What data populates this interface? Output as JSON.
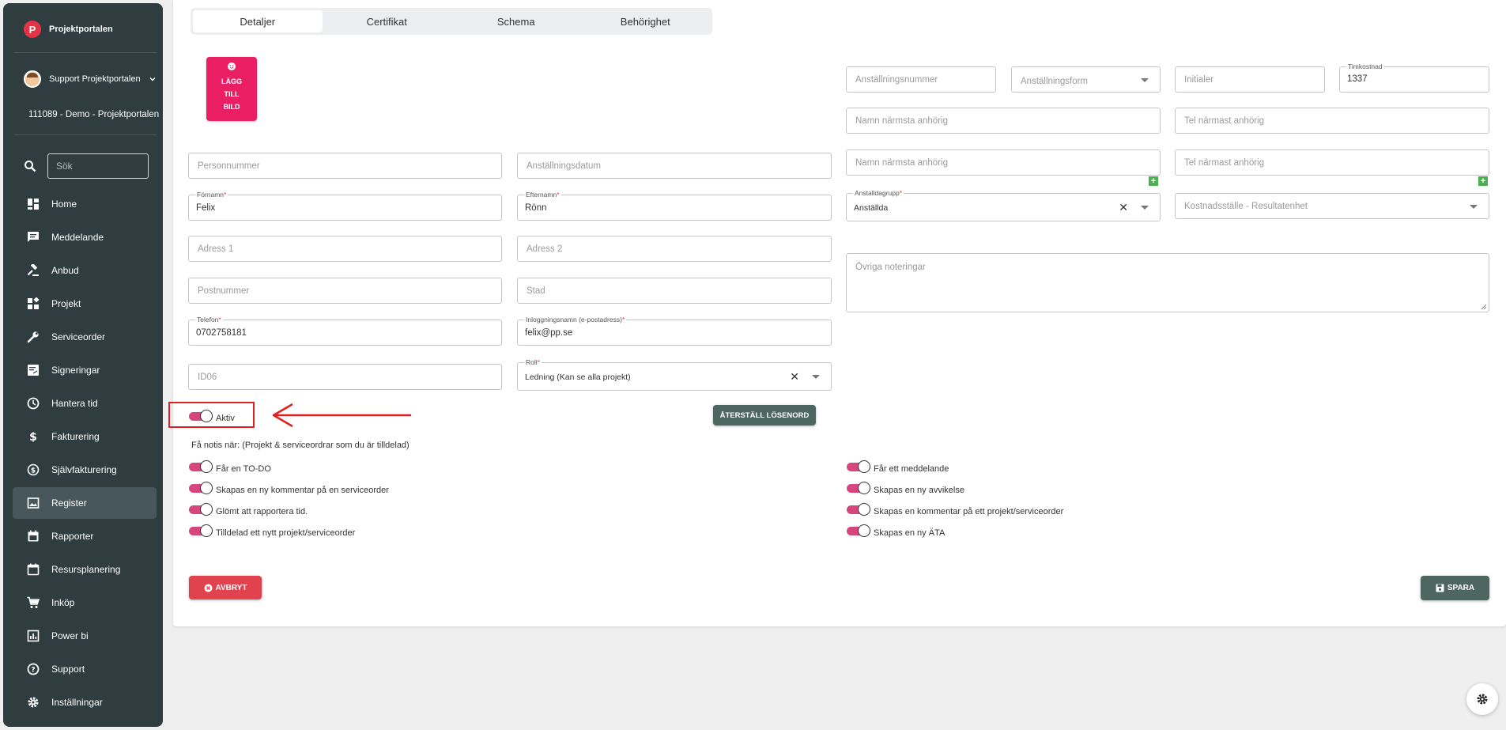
{
  "brand": {
    "name": "Projektportalen",
    "logo_letter": "P"
  },
  "user": {
    "name": "Support Projektportalen"
  },
  "company": "111089 - Demo - Projektportalen",
  "search": {
    "placeholder": "Sök"
  },
  "nav": [
    {
      "label": "Home",
      "icon": "dashboard-icon"
    },
    {
      "label": "Meddelande",
      "icon": "chat-icon"
    },
    {
      "label": "Anbud",
      "icon": "gavel-icon"
    },
    {
      "label": "Projekt",
      "icon": "widgets-icon"
    },
    {
      "label": "Serviceorder",
      "icon": "wrench-icon"
    },
    {
      "label": "Signeringar",
      "icon": "signature-icon"
    },
    {
      "label": "Hantera tid",
      "icon": "clock-icon"
    },
    {
      "label": "Fakturering",
      "icon": "dollar-icon"
    },
    {
      "label": "Självfakturering",
      "icon": "dollar-circle-icon"
    },
    {
      "label": "Register",
      "icon": "image-icon",
      "active": true
    },
    {
      "label": "Rapporter",
      "icon": "calendar-icon"
    },
    {
      "label": "Resursplanering",
      "icon": "calendar-outline-icon"
    },
    {
      "label": "Inköp",
      "icon": "cart-icon"
    },
    {
      "label": "Power bi",
      "icon": "chart-icon"
    },
    {
      "label": "Support",
      "icon": "help-icon"
    },
    {
      "label": "Inställningar",
      "icon": "gear-icon"
    }
  ],
  "tabs": [
    "Detaljer",
    "Certifikat",
    "Schema",
    "Behörighet"
  ],
  "photo": {
    "line1": "LÄGG",
    "line2": "TILL",
    "line3": "BILD"
  },
  "fields": {
    "anstallningsnummer": "Anställningsnummer",
    "anstallningsform": "Anställningsform",
    "initialer": "Initialer",
    "timkostnad_label": "Timkostnad",
    "timkostnad_value": "1337",
    "namn_anhorig_1": "Namn närmsta anhörig",
    "tel_anhorig_1": "Tel närmast anhörig",
    "namn_anhorig_2": "Namn närmsta anhörig",
    "tel_anhorig_2": "Tel närmast anhörig",
    "anstalldagrupp_label": "Anstalldagrupp",
    "anstalldagrupp_value": "Anställda",
    "kostnadsstalle": "Kostnadsställe - Resultatenhet",
    "ovriga": "Övriga noteringar",
    "personnummer": "Personnummer",
    "anstallningsdatum": "Anställningsdatum",
    "fornamn_label": "Förnamn",
    "fornamn_value": "Felix",
    "efternamn_label": "Efternamn",
    "efternamn_value": "Rönn",
    "adress1": "Adress 1",
    "adress2": "Adress 2",
    "postnummer": "Postnummer",
    "stad": "Stad",
    "telefon_label": "Telefon",
    "telefon_value": "0702758181",
    "inlogg_label": "Inloggningsnamn (e-postadress)",
    "inlogg_value": "felix@pp.se",
    "id06": "ID06",
    "roll_label": "Roll",
    "roll_value": "Ledning (Kan se alla projekt)"
  },
  "required_mark": "*",
  "aktiv_label": "Aktiv",
  "reset_password": "ÅTERSTÄLL LÖSENORD",
  "notify_heading": "Få notis när: (Projekt & serviceordrar som du är tilldelad)",
  "notify_left": [
    "Får en TO-DO",
    "Skapas en ny kommentar på en serviceorder",
    "Glömt att rapportera tid.",
    "Tilldelad ett nytt projekt/serviceorder"
  ],
  "notify_right": [
    "Får ett meddelande",
    "Skapas en ny avvikelse",
    "Skapas en kommentar på ett projekt/serviceorder",
    "Skapas en ny ÄTA"
  ],
  "buttons": {
    "cancel": "AVBRYT",
    "save": "SPARA"
  },
  "colors": {
    "sidebar": "#2f3d41",
    "accent": "#d6457e",
    "photo": "#e91e63",
    "save": "#4d6660",
    "cancel": "#e0424e",
    "annotation": "#e02020"
  }
}
